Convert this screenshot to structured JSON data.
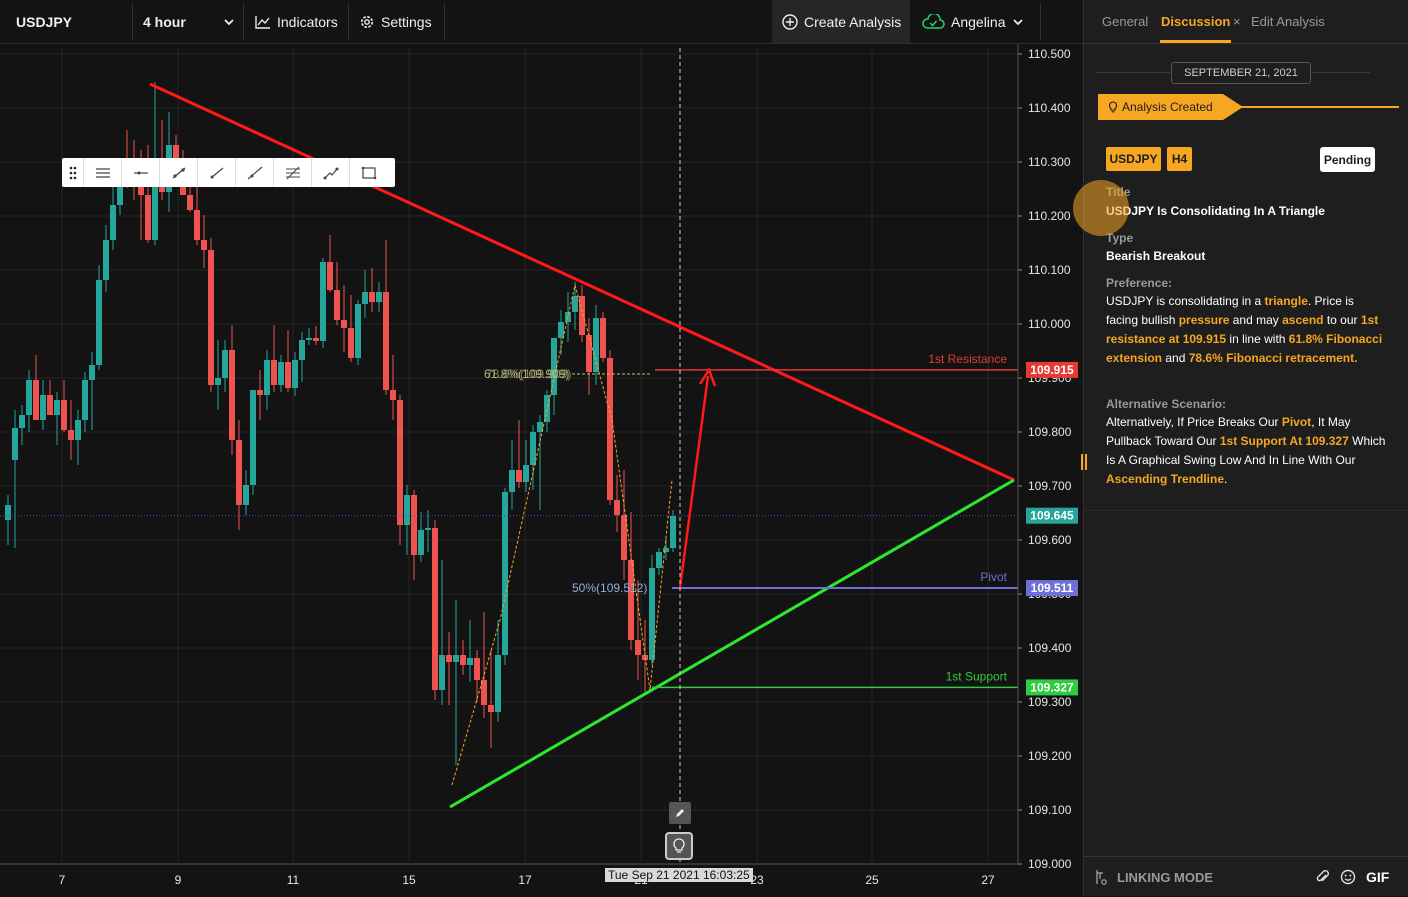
{
  "topbar": {
    "symbol": "USDJPY",
    "interval": "4 hour",
    "indicators": "Indicators",
    "settings": "Settings",
    "create_analysis": "Create Analysis",
    "user": "Angelina"
  },
  "chart": {
    "price_ticks": [
      "110.500",
      "110.400",
      "110.300",
      "110.200",
      "110.100",
      "110.000",
      "109.900",
      "109.800",
      "109.700",
      "109.600",
      "109.500",
      "109.400",
      "109.300",
      "109.200",
      "109.100",
      "109.000"
    ],
    "date_ticks": [
      "7",
      "9",
      "11",
      "15",
      "17",
      "21",
      "23",
      "25",
      "27"
    ],
    "crosshair_time": "Tue Sep 21 2021 16:03:25",
    "current_price": "109.645",
    "levels": {
      "resistance": {
        "label": "1st Resistance",
        "price": "109.915",
        "color": "#e53935"
      },
      "pivot": {
        "label": "Pivot",
        "price": "109.511",
        "color": "#6f6fd6"
      },
      "support": {
        "label": "1st Support",
        "price": "109.327",
        "color": "#2ecc40"
      }
    },
    "fib_labels": {
      "upper": "78.6%(109.909)",
      "upper_overlap": "61.8%(109.909)",
      "mid": "50%(109.512)"
    },
    "colors": {
      "up": "#26a69a",
      "down": "#ef5350",
      "trend_down": "#ff1a1a",
      "trend_up": "#2ee82e",
      "fib": "#f5a623"
    }
  },
  "panel": {
    "tabs": {
      "general": "General",
      "discussion": "Discussion",
      "close": "×",
      "edit": "Edit Analysis"
    },
    "date": "SEPTEMBER 21, 2021",
    "created": "Analysis Created",
    "symbol_badge": "USDJPY",
    "tf_badge": "H4",
    "status": "Pending",
    "title_label": "Title",
    "title": "USDJPY Is Consolidating In A Triangle",
    "type_label": "Type",
    "type": "Bearish Breakout",
    "preference_label": "Preference:",
    "preference": [
      [
        "USDJPY is consolidating in a ",
        false
      ],
      [
        "triangle",
        true
      ],
      [
        ". Price is facing bullish ",
        false
      ],
      [
        "pressure",
        true
      ],
      [
        " and may ",
        false
      ],
      [
        "ascend",
        true
      ],
      [
        " to our ",
        false
      ],
      [
        "1st resistance at 109.915",
        true
      ],
      [
        " in line with ",
        false
      ],
      [
        "61.8% Fibonacci extension",
        true
      ],
      [
        " and ",
        false
      ],
      [
        "78.6% Fibonacci retracement.",
        true
      ]
    ],
    "alternative_label": "Alternative Scenario:",
    "alternative": [
      [
        "Alternatively, If Price Breaks Our ",
        false
      ],
      [
        "Pivot",
        true
      ],
      [
        ", It May Pullback Toward Our ",
        false
      ],
      [
        "1st Support At 109.327",
        true
      ],
      [
        " Which Is A Graphical Swing Low And In Line With Our ",
        false
      ],
      [
        "Ascending Trendline",
        true
      ],
      [
        ".",
        false
      ]
    ],
    "footer": {
      "linking": "LINKING MODE",
      "gif": "GIF"
    }
  }
}
